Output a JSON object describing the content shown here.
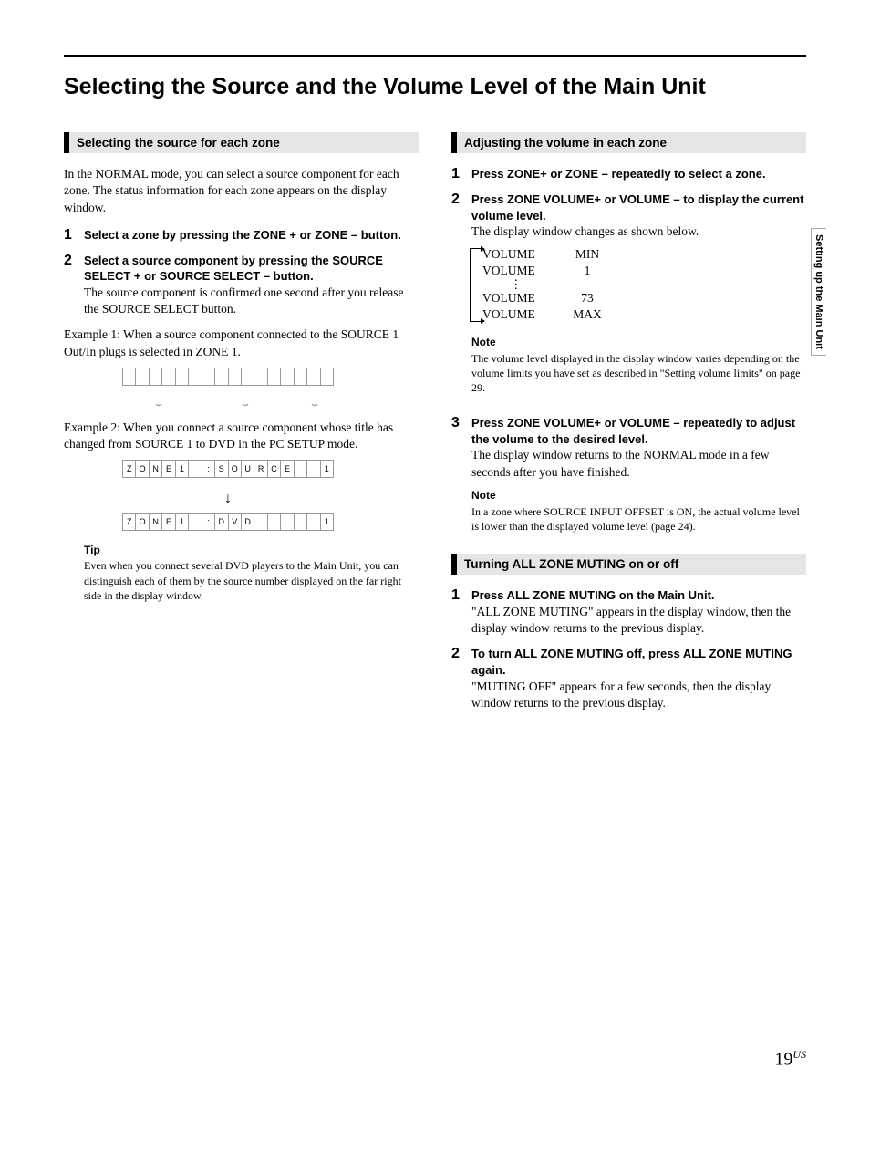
{
  "title": "Selecting the Source and the Volume Level of the Main Unit",
  "side_tab": "Setting up the Main Unit",
  "page_number": "19",
  "page_suffix": "US",
  "left": {
    "section_head": "Selecting the source for each zone",
    "intro": "In the NORMAL mode, you can select a source component for each zone. The status information for each zone appears on the display window.",
    "step1_bold": "Select a zone by pressing the ZONE + or ZONE – button.",
    "step2_bold": "Select a source component by pressing the SOURCE SELECT + or SOURCE SELECT – button.",
    "step2_body": "The source component is confirmed one second after you release the SOURCE SELECT button.",
    "example1": "Example 1: When a source component connected to the SOURCE 1 Out/In plugs is selected in ZONE 1.",
    "example2": "Example 2: When you connect a source component whose title has changed from SOURCE 1 to DVD in the PC SETUP mode.",
    "lcd2a": [
      "Z",
      "O",
      "N",
      "E",
      "1",
      "",
      ":",
      "S",
      "O",
      "U",
      "R",
      "C",
      "E",
      "",
      "",
      "1"
    ],
    "lcd2b": [
      "Z",
      "O",
      "N",
      "E",
      "1",
      "",
      ":",
      "D",
      "V",
      "D",
      "",
      "",
      "",
      "",
      "",
      "1"
    ],
    "tip_head": "Tip",
    "tip_body": "Even when you connect several DVD players to the Main Unit, you can distinguish each of them by the source number displayed on the far right side in the display window."
  },
  "right": {
    "section1_head": "Adjusting the volume in each zone",
    "s1_step1_bold": "Press ZONE+ or ZONE – repeatedly to select a zone.",
    "s1_step2_bold": "Press ZONE VOLUME+ or VOLUME – to display the current volume level.",
    "s1_step2_body": "The display window changes as shown below.",
    "vol": {
      "label": "VOLUME",
      "min": "MIN",
      "one": "1",
      "seventythree": "73",
      "max": "MAX"
    },
    "note1_head": "Note",
    "note1_body": "The volume level displayed in the display window varies depending on the volume limits you have set as described in \"Setting volume limits\" on page 29.",
    "s1_step3_bold": "Press ZONE VOLUME+ or VOLUME – repeatedly to adjust the volume to the desired level.",
    "s1_step3_body": "The display window returns to the NORMAL mode in a few seconds after you have finished.",
    "note2_head": "Note",
    "note2_body": "In a zone where SOURCE INPUT OFFSET is ON, the actual volume level is lower than the displayed volume level (page 24).",
    "section2_head": "Turning ALL ZONE MUTING on or off",
    "s2_step1_bold": "Press ALL ZONE MUTING on the Main Unit.",
    "s2_step1_body": "\"ALL ZONE MUTING\" appears in the display window, then the display window returns to the previous display.",
    "s2_step2_bold": "To turn ALL ZONE MUTING off, press ALL ZONE MUTING again.",
    "s2_step2_body": "\"MUTING OFF\" appears for a few seconds, then the display window returns to the previous display."
  }
}
